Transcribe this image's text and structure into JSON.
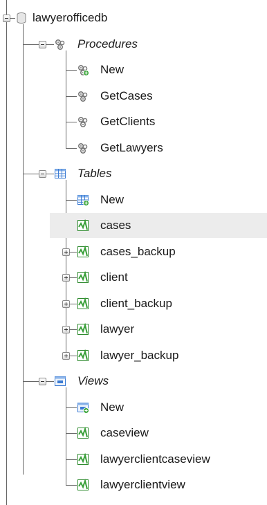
{
  "database": {
    "label": "lawyerofficedb",
    "icon": "database-icon"
  },
  "procedures": {
    "label": "Procedures",
    "icon": "procedures-group-icon",
    "items": [
      {
        "label": "New",
        "icon": "new-procedure-icon"
      },
      {
        "label": "GetCases",
        "icon": "procedure-icon"
      },
      {
        "label": "GetClients",
        "icon": "procedure-icon"
      },
      {
        "label": "GetLawyers",
        "icon": "procedure-icon"
      }
    ]
  },
  "tables": {
    "label": "Tables",
    "icon": "tables-group-icon",
    "items": [
      {
        "label": "New",
        "icon": "new-table-icon"
      },
      {
        "label": "cases",
        "icon": "table-icon",
        "highlighted": true
      },
      {
        "label": "cases_backup",
        "icon": "table-icon"
      },
      {
        "label": "client",
        "icon": "table-icon"
      },
      {
        "label": "client_backup",
        "icon": "table-icon"
      },
      {
        "label": "lawyer",
        "icon": "table-icon"
      },
      {
        "label": "lawyer_backup",
        "icon": "table-icon"
      }
    ]
  },
  "views": {
    "label": "Views",
    "icon": "views-group-icon",
    "items": [
      {
        "label": "New",
        "icon": "new-view-icon"
      },
      {
        "label": "caseview",
        "icon": "view-icon"
      },
      {
        "label": "lawyerclientcaseview",
        "icon": "view-icon"
      },
      {
        "label": "lawyerclientview",
        "icon": "view-icon"
      }
    ]
  },
  "colors": {
    "tree_line": "#666666",
    "row_highlight": "#ececec",
    "table_icon": "#3aa03a",
    "grid_icon": "#3b7bd3",
    "new_badge": "#2fa02f"
  }
}
